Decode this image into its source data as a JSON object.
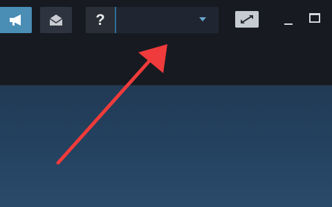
{
  "toolbar": {
    "announcements": {
      "icon": "megaphone-icon"
    },
    "notifications": {
      "icon": "envelope-icon"
    },
    "help": {
      "icon": "question-mark-icon",
      "label": "?"
    },
    "account": {
      "name": "",
      "icon": "chevron-down-icon"
    },
    "big_picture": {
      "icon": "fullscreen-arrows-icon"
    },
    "window_controls": {
      "minimize_icon": "minimize-icon",
      "maximize_icon": "maximize-icon"
    }
  },
  "annotation": {
    "color": "#ef3b3b",
    "icon": "red-arrow-icon"
  },
  "colors": {
    "titlebar": "#171a21",
    "accent": "#4a8db5",
    "content_top": "#223a55",
    "content_bottom": "#2a4a6a"
  }
}
